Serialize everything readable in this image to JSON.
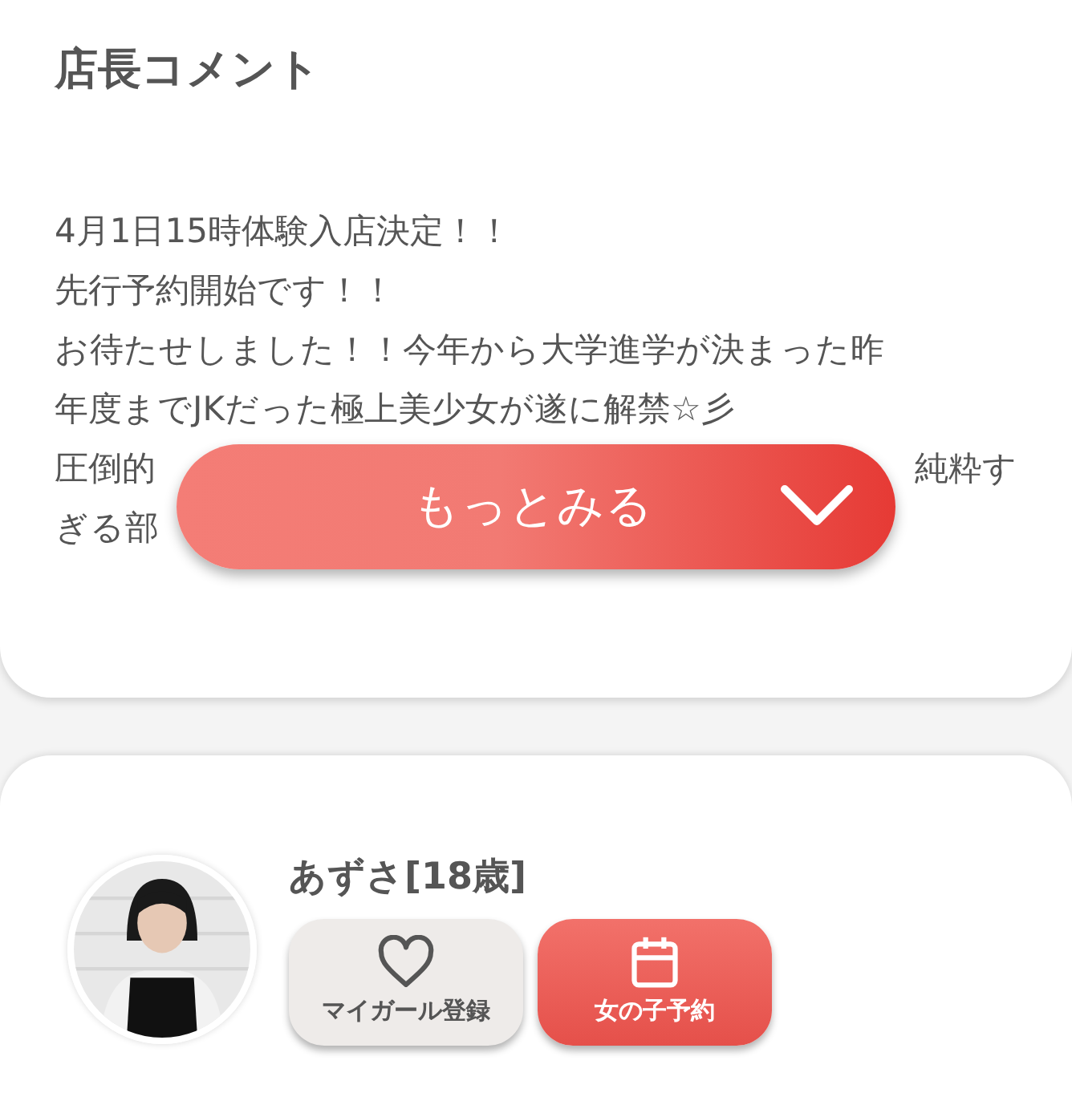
{
  "comment_card": {
    "title": "店長コメント",
    "lines": [
      {
        "left": "4月1日15時体験入店決定！！"
      },
      {
        "left": "先行予約開始です！！"
      },
      {
        "left": "お待たせしました！！今年から大学進学が決まった昨"
      },
      {
        "left": "年度までJKだった極上美少女が遂に解禁☆彡"
      },
      {
        "left": "圧倒的",
        "right": "純粋す"
      },
      {
        "left": "ぎる部"
      }
    ],
    "more_button": {
      "label": "もっとみる",
      "expanded": false
    }
  },
  "profile_card": {
    "name": "あずさ[18歳]",
    "buttons": [
      {
        "kind": "favorite",
        "label": "マイガール登録"
      },
      {
        "kind": "reserve",
        "label": "女の子予約"
      }
    ]
  }
}
